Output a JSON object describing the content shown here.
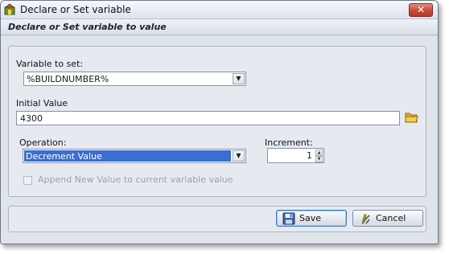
{
  "window": {
    "title": "Declare or Set variable",
    "close_glyph": "✕"
  },
  "header": {
    "text": "Declare or Set variable to value"
  },
  "form": {
    "variable_label": "Variable to set:",
    "variable_value": "%BUILDNUMBER%",
    "initial_label": "Initial Value",
    "initial_value": "4300",
    "operation_label": "Operation:",
    "operation_value": "Decrement Value",
    "increment_label": "Increment:",
    "increment_value": "1",
    "append_label": "Append New Value to current variable value",
    "append_checked": false,
    "append_enabled": false
  },
  "buttons": {
    "save_label": "Save",
    "cancel_label": "Cancel"
  },
  "icons": {
    "app": "app-icon",
    "folder": "folder-icon",
    "save": "floppy-disk-icon",
    "cancel": "cancel-icon",
    "dropdown": "chevron-down-icon"
  },
  "colors": {
    "selection": "#3a6ed0",
    "close": "#c44a38",
    "panel": "#e6eaf0"
  }
}
